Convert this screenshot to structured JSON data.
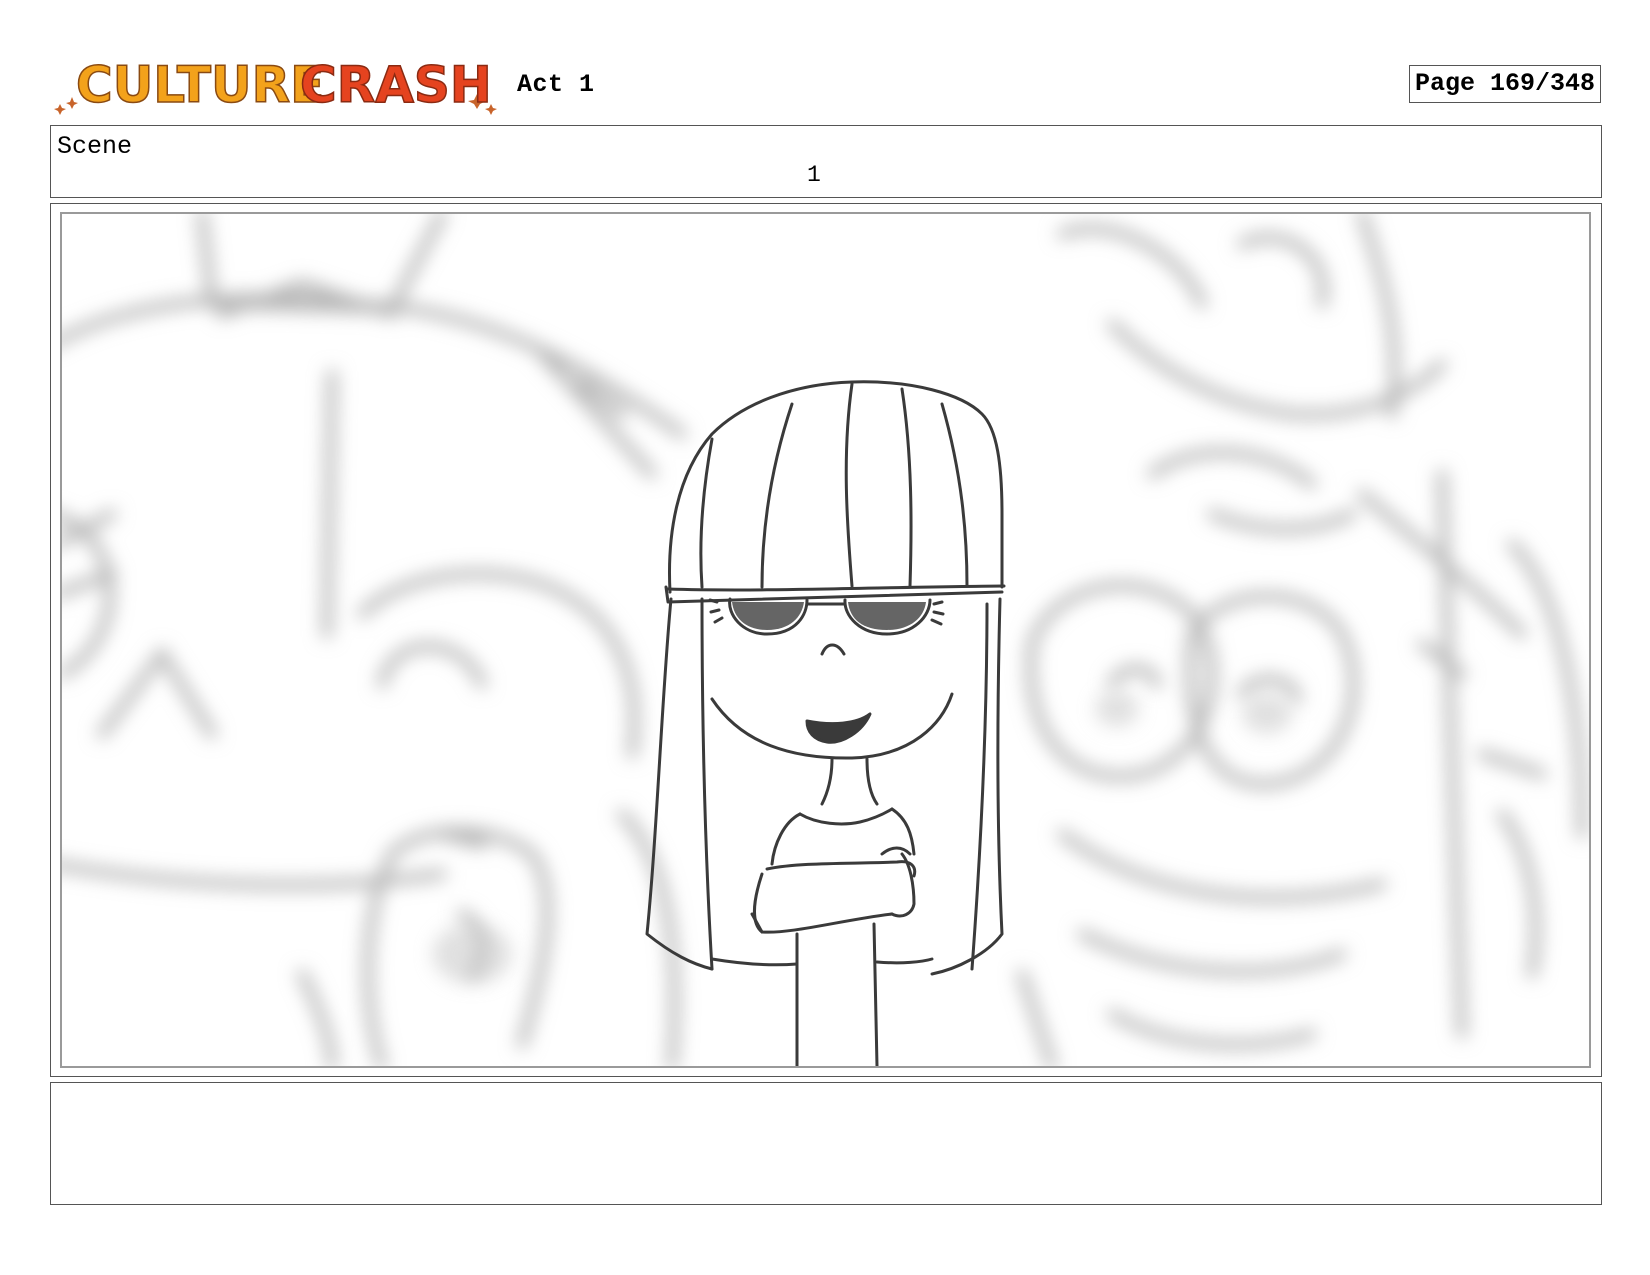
{
  "header": {
    "logo_text": "CULTURE CRASH",
    "logo_word_1": "CULTURE",
    "logo_word_2": "CRASH",
    "logo_colors": {
      "culture": "#f3a21b",
      "crash": "#e5431f",
      "outline": "#8a4a12"
    },
    "act": "Act 1",
    "page": "Page 169/348"
  },
  "scene": {
    "label": "Scene",
    "number": "1"
  },
  "panel": {
    "image": "storyboard-sketch-girl-arms-crossed"
  },
  "notes": {
    "text": ""
  }
}
